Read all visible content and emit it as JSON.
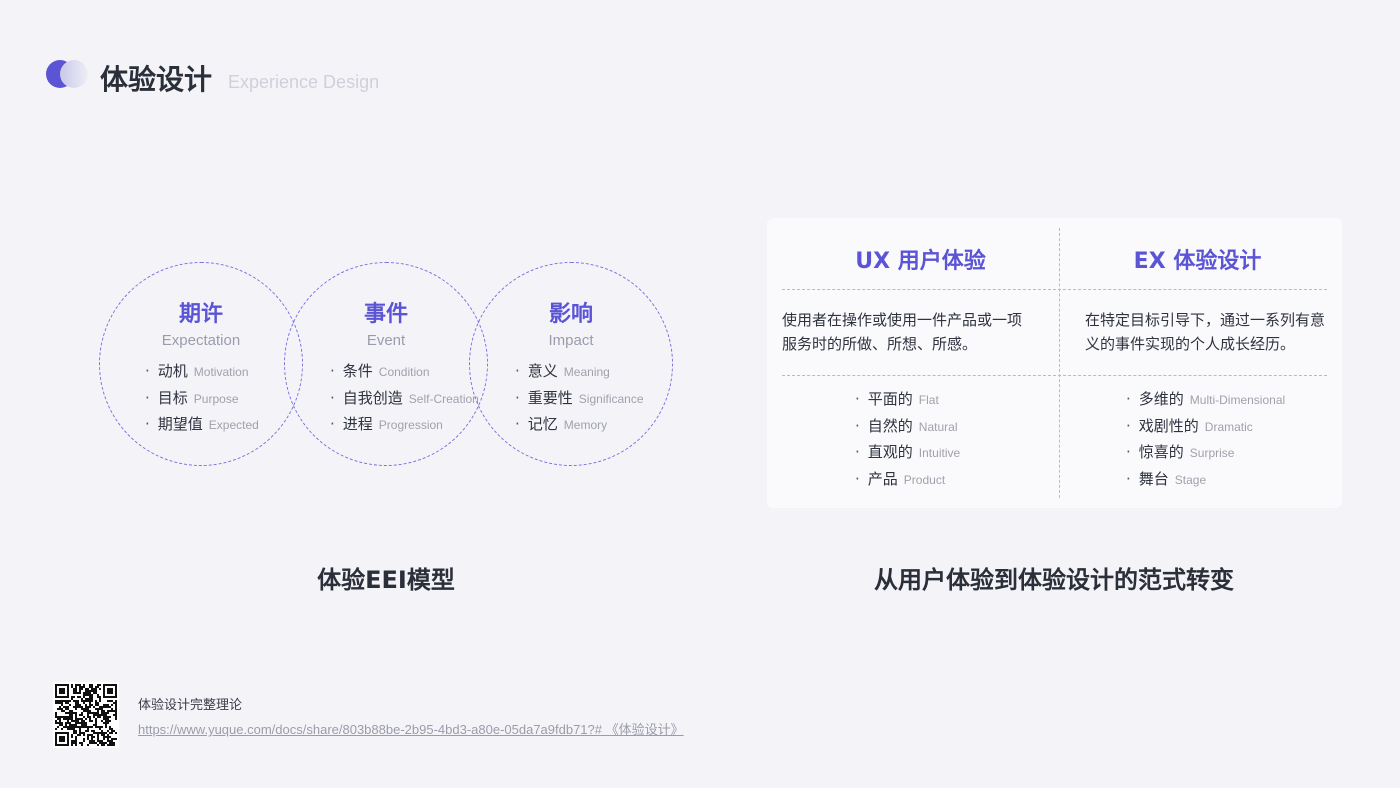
{
  "header": {
    "title": "体验设计",
    "subtitle": "Experience Design"
  },
  "eei": {
    "circles": [
      {
        "title": "期许",
        "sub": "Expectation",
        "items": [
          {
            "zh": "动机",
            "en": "Motivation"
          },
          {
            "zh": "目标",
            "en": "Purpose"
          },
          {
            "zh": "期望值",
            "en": "Expected"
          }
        ]
      },
      {
        "title": "事件",
        "sub": "Event",
        "items": [
          {
            "zh": "条件",
            "en": "Condition"
          },
          {
            "zh": "自我创造",
            "en": "Self-Creation"
          },
          {
            "zh": "进程",
            "en": "Progression"
          }
        ]
      },
      {
        "title": "影响",
        "sub": "Impact",
        "items": [
          {
            "zh": "意义",
            "en": "Meaning"
          },
          {
            "zh": "重要性",
            "en": "Significance"
          },
          {
            "zh": "记忆",
            "en": "Memory"
          }
        ]
      }
    ],
    "caption": "体验EEI模型",
    "bullet": "·"
  },
  "compare": {
    "columns": [
      {
        "title": "UX  用户体验",
        "desc": "使用者在操作或使用一件产品或一项服务时的所做、所想、所感。",
        "items": [
          {
            "zh": "平面的",
            "en": "Flat"
          },
          {
            "zh": "自然的",
            "en": "Natural"
          },
          {
            "zh": "直观的",
            "en": "Intuitive"
          },
          {
            "zh": "产品",
            "en": "Product"
          }
        ]
      },
      {
        "title": "EX  体验设计",
        "desc": "在特定目标引导下，通过一系列有意义的事件实现的个人成长经历。",
        "items": [
          {
            "zh": "多维的",
            "en": "Multi-Dimensional"
          },
          {
            "zh": "戏剧性的",
            "en": "Dramatic"
          },
          {
            "zh": "惊喜的",
            "en": "Surprise"
          },
          {
            "zh": "舞台",
            "en": "Stage"
          }
        ]
      }
    ],
    "caption": "从用户体验到体验设计的范式转变"
  },
  "footer": {
    "qr_title": "体验设计完整理论",
    "link": "https://www.yuque.com/docs/share/803b88be-2b95-4bd3-a80e-05da7a9fdb71?# 《体验设计》"
  },
  "colors": {
    "accent": "#5b55d6",
    "background": "#f4f4f8"
  }
}
